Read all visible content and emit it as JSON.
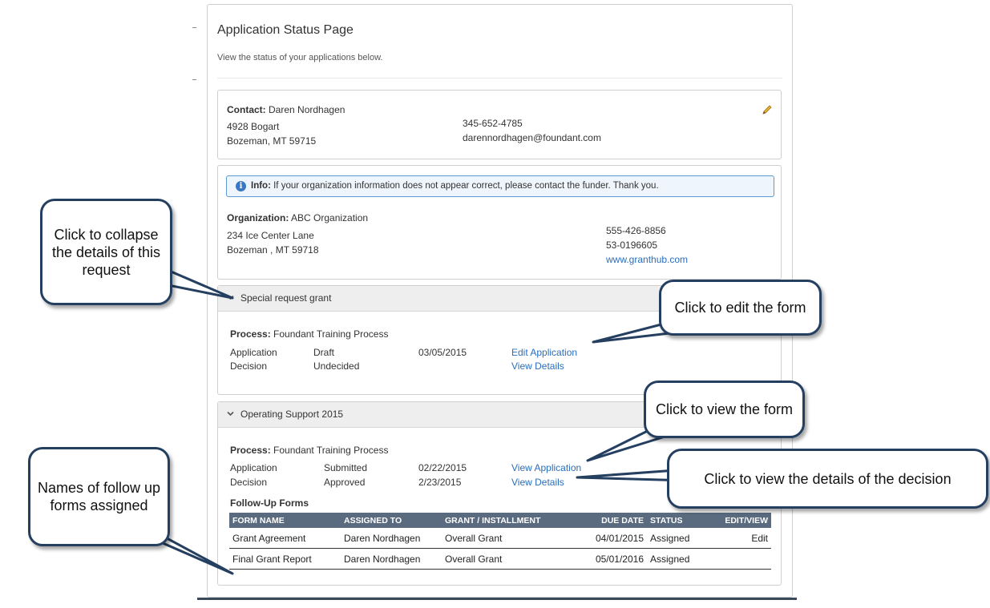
{
  "page": {
    "title": "Application Status Page",
    "subtitle": "View the status of your applications below."
  },
  "contact": {
    "label": "Contact:",
    "name": "Daren Nordhagen",
    "address_line1": "4928 Bogart",
    "address_line2": "Bozeman, MT 59715",
    "phone": "345-652-4785",
    "email": "darennordhagen@foundant.com",
    "edit_icon": "pencil-icon"
  },
  "organization": {
    "info_label": "Info:",
    "info_text": "If your organization information does not appear correct, please contact the funder. Thank you.",
    "label": "Organization:",
    "name": "ABC Organization",
    "address_line1": "234 Ice Center Lane",
    "address_line2": "Bozeman , MT 59718",
    "phone": "555-426-8856",
    "tax_id": "53-0196605",
    "website": "www.granthub.com"
  },
  "requests": [
    {
      "title": "Special request grant",
      "process_label": "Process:",
      "process": "Foundant Training Process",
      "rows": [
        {
          "type": "Application",
          "status": "Draft",
          "date": "03/05/2015",
          "action": "Edit Application"
        },
        {
          "type": "Decision",
          "status": "Undecided",
          "date": "",
          "action": "View Details"
        }
      ]
    },
    {
      "title": "Operating Support 2015",
      "process_label": "Process:",
      "process": "Foundant Training Process",
      "rows": [
        {
          "type": "Application",
          "status": "Submitted",
          "date": "02/22/2015",
          "action": "View Application"
        },
        {
          "type": "Decision",
          "status": "Approved",
          "date": "2/23/2015",
          "action": "View Details"
        }
      ],
      "followup_title": "Follow-Up Forms",
      "followup_columns": [
        "FORM NAME",
        "ASSIGNED TO",
        "GRANT / INSTALLMENT",
        "DUE DATE",
        "STATUS",
        "EDIT/VIEW"
      ],
      "followup_rows": [
        {
          "form": "Grant Agreement",
          "assigned": "Daren Nordhagen",
          "grant": "Overall Grant",
          "due": "04/01/2015",
          "status": "Assigned",
          "action": "Edit"
        },
        {
          "form": "Final Grant Report",
          "assigned": "Daren Nordhagen",
          "grant": "Overall Grant",
          "due": "05/01/2016",
          "status": "Assigned",
          "action": ""
        }
      ]
    }
  ],
  "callouts": {
    "collapse": "Click to collapse the details of this request",
    "edit_form": "Click to edit the form",
    "view_form": "Click to view the form",
    "view_decision": "Click to view the details of the decision",
    "followup_names": "Names of follow up forms assigned"
  },
  "colors": {
    "link": "#2a6ebb",
    "table_header": "#5a6b80",
    "callout_border": "#243f60",
    "info_border": "#5b9bd5"
  }
}
